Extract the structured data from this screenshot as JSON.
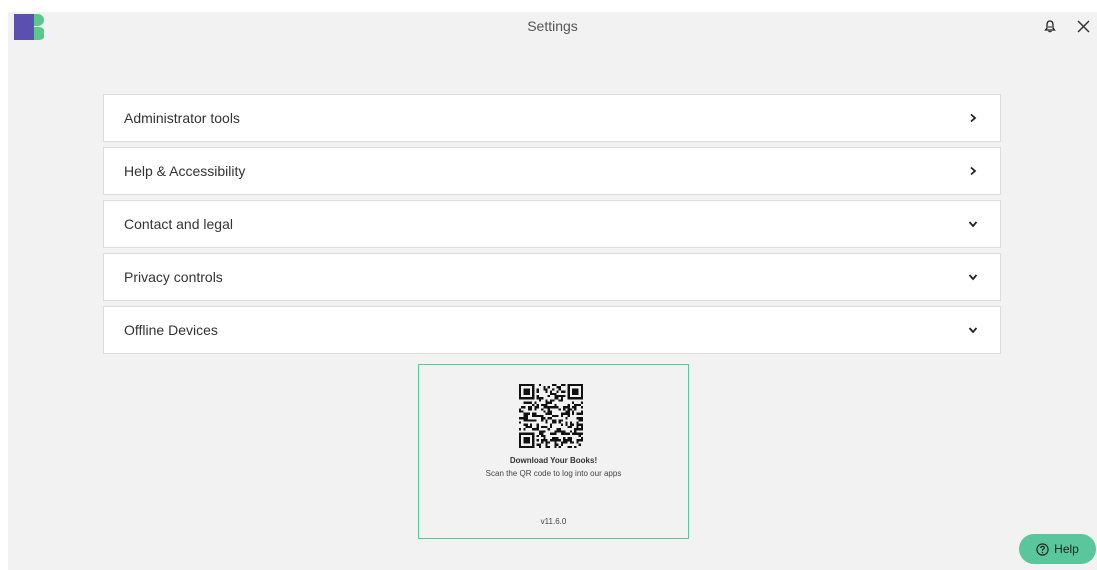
{
  "app": {
    "title": "Settings"
  },
  "topbar": {
    "notify_icon": "bell-icon",
    "close_icon": "close-icon"
  },
  "menu": {
    "items": [
      {
        "label": "Administrator tools",
        "chevron": "chevron-right-icon"
      },
      {
        "label": "Help & Accessibility",
        "chevron": "chevron-right-icon"
      },
      {
        "label": "Contact and legal",
        "chevron": "chevron-down-icon"
      },
      {
        "label": "Privacy controls",
        "chevron": "chevron-down-icon"
      },
      {
        "label": "Offline Devices",
        "chevron": "chevron-down-icon"
      }
    ]
  },
  "qr": {
    "title": "Download Your Books!",
    "subtitle": "Scan the QR code to log into our apps",
    "version": "v11.6.0"
  },
  "help": {
    "label": "Help"
  },
  "colors": {
    "accent": "#59c69b",
    "logo_purple": "#5b4fb0",
    "logo_green": "#5ac88c",
    "background": "#f2f2f2"
  }
}
